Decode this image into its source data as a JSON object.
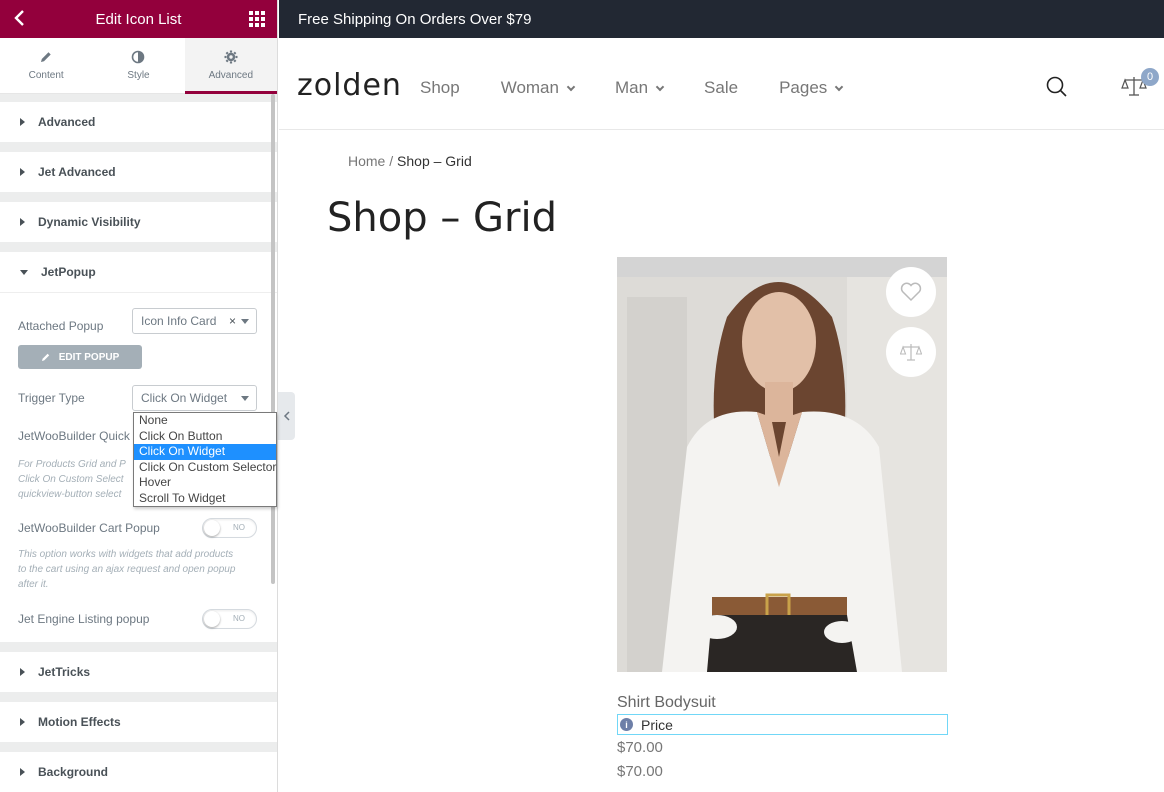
{
  "panel": {
    "title": "Edit Icon List",
    "tabs": [
      {
        "label": "Content",
        "icon": "pencil-icon"
      },
      {
        "label": "Style",
        "icon": "half-circle-icon"
      },
      {
        "label": "Advanced",
        "icon": "gear-icon",
        "active": true
      }
    ],
    "sections_top": [
      "Advanced",
      "Jet Advanced",
      "Dynamic Visibility"
    ],
    "jetpopup": {
      "title": "JetPopup",
      "attached_label": "Attached Popup",
      "attached_value": "Icon Info Card",
      "attached_clear": "×",
      "edit_button": "EDIT POPUP",
      "trigger_label": "Trigger Type",
      "trigger_value": "Click On Widget",
      "trigger_options": [
        "None",
        "Click On Button",
        "Click On Widget",
        "Click On Custom Selector",
        "Hover",
        "Scroll To Widget"
      ],
      "quick_label": "JetWooBuilder Quick",
      "quick_hint": "For Products Grid and P Click On Custom Select quickview-button select",
      "cart_label": "JetWooBuilder Cart Popup",
      "cart_toggle": "NO",
      "cart_hint": "This option works with widgets that add products to the cart using an ajax request and open popup after it.",
      "engine_label": "Jet Engine Listing popup",
      "engine_toggle": "NO"
    },
    "sections_bottom": [
      "JetTricks",
      "Motion Effects",
      "Background"
    ],
    "accent_color": "#93003c"
  },
  "site": {
    "promo": "Free Shipping On Orders Over $79",
    "logo": "zolden",
    "nav": [
      {
        "label": "Shop",
        "dropdown": false
      },
      {
        "label": "Woman",
        "dropdown": true
      },
      {
        "label": "Man",
        "dropdown": true
      },
      {
        "label": "Sale",
        "dropdown": false
      },
      {
        "label": "Pages",
        "dropdown": true
      }
    ],
    "compare_count": "0",
    "breadcrumb_home": "Home",
    "breadcrumb_sep": " / ",
    "breadcrumb_current": "Shop – Grid",
    "page_title": "Shop – Grid",
    "product": {
      "name": "Shirt Bodysuit",
      "price_label": "Price",
      "price1": "$70.00",
      "price2": "$70.00"
    }
  }
}
